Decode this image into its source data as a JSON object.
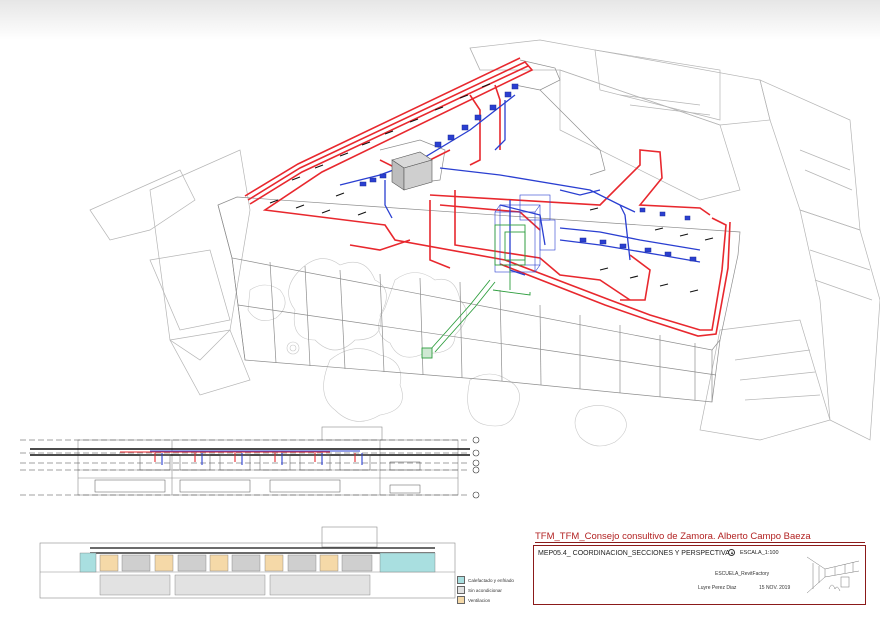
{
  "project_title": "TFM_TFM_Consejo consultivo de Zamora. Alberto Campo Baeza",
  "sheet": {
    "code": "MEP05.4_",
    "name": "COORDINACION_SECCIONES Y PERSPECTIVA",
    "scale": "ESCALA_1:100",
    "school": "ESCUELA_RevitFactory",
    "author": "Luyre Perez Diaz",
    "date": "15 NOV. 2019"
  },
  "legend": [
    {
      "label": "Calefactado y enfriado",
      "color": "#a9dfe0"
    },
    {
      "label": "Sin acondicionar",
      "color": "#e2e2e2"
    },
    {
      "label": "Ventilacion",
      "color": "#f5d9a8"
    }
  ],
  "colors": {
    "supply_duct": "#e8282e",
    "return_duct": "#2a3fd1",
    "drainage": "#2e9e3e",
    "title_red": "#b22222"
  }
}
